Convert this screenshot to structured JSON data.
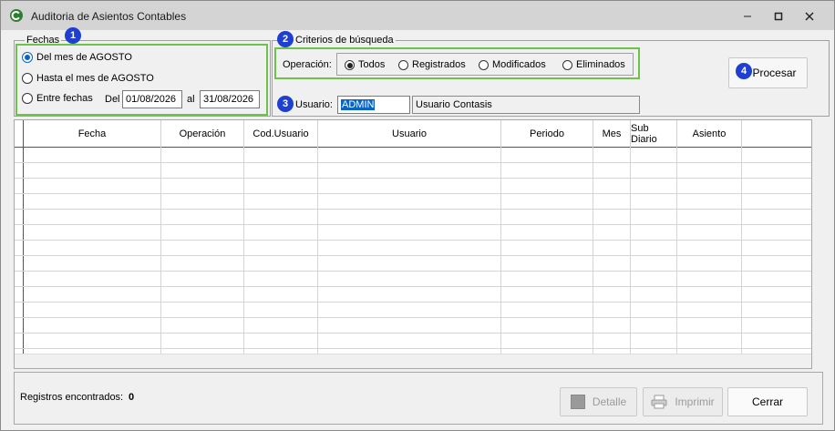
{
  "window": {
    "title": "Auditoria de Asientos Contables",
    "controls": {
      "minimize": "minimize-icon",
      "maximize": "maximize-icon",
      "close": "close-icon"
    }
  },
  "fechas": {
    "title": "Fechas",
    "badge": "1",
    "options": [
      {
        "label": "Del mes de AGOSTO",
        "selected": true
      },
      {
        "label": "Hasta el mes de AGOSTO",
        "selected": false
      },
      {
        "label": "Entre fechas",
        "selected": false
      }
    ],
    "del_label": "Del",
    "al_label": "al",
    "date_from": "01/08/2026",
    "date_to": "31/08/2026"
  },
  "criterios": {
    "title": "Criterios de búsqueda",
    "badge": "2",
    "operacion_label": "Operación:",
    "operaciones": [
      {
        "label": "Todos",
        "selected": true
      },
      {
        "label": "Registrados",
        "selected": false
      },
      {
        "label": "Modificados",
        "selected": false
      },
      {
        "label": "Eliminados",
        "selected": false
      }
    ],
    "usuario_badge": "3",
    "usuario_label": "Usuario:",
    "usuario_value": "ADMIN",
    "usuario_name": "Usuario Contasis"
  },
  "procesar": {
    "badge": "4",
    "label": "Procesar"
  },
  "grid": {
    "columns": [
      "Fecha",
      "Operación",
      "Cod.Usuario",
      "Usuario",
      "Periodo",
      "Mes",
      "Sub Diario",
      "Asiento"
    ]
  },
  "footer": {
    "registros_label": "Registros encontrados:",
    "registros_count": "0",
    "detalle_label": "Detalle",
    "imprimir_label": "Imprimir",
    "cerrar_label": "Cerrar"
  },
  "colors": {
    "highlight": "#6cc24a",
    "badge": "#1f3fd1",
    "selection": "#0a64c8"
  }
}
